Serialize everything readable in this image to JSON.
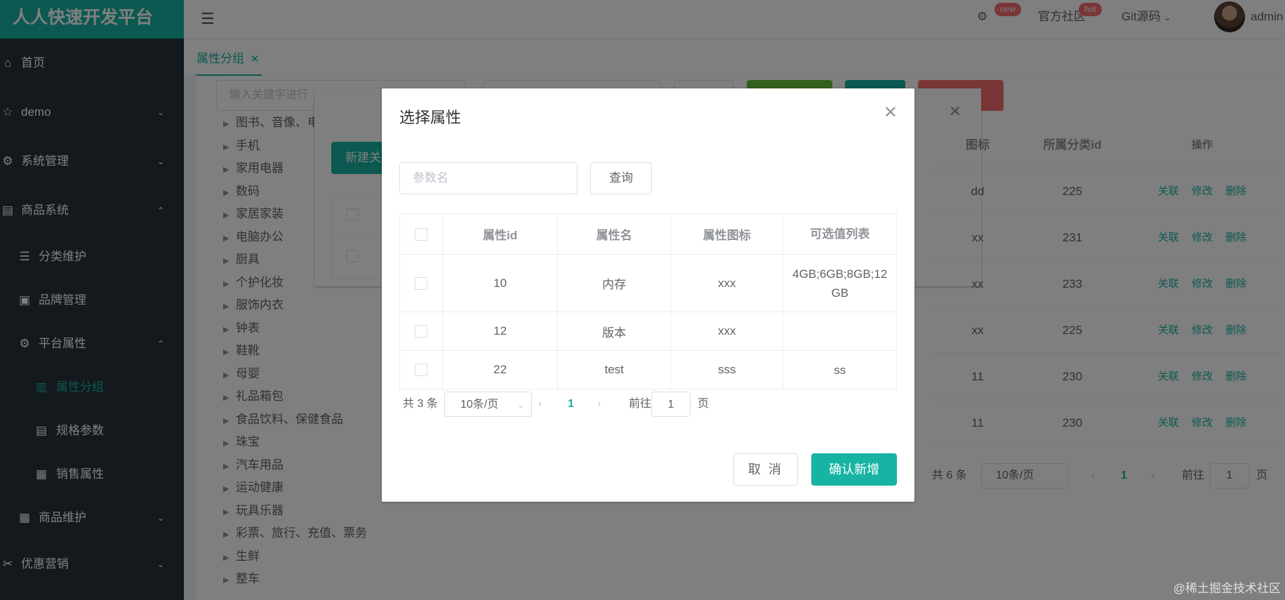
{
  "app": {
    "brand": "人人快速开发平台",
    "accent": "#17b3a3"
  },
  "sidebar": {
    "items": [
      {
        "label": "首页",
        "icon": "home-icon"
      },
      {
        "label": "demo",
        "icon": "star-icon"
      },
      {
        "label": "系统管理",
        "icon": "gear-icon"
      },
      {
        "label": "商品系统",
        "icon": "product-icon"
      },
      {
        "label": "分类维护",
        "icon": "list-icon"
      },
      {
        "label": "品牌管理",
        "icon": "brand-icon"
      },
      {
        "label": "平台属性",
        "icon": "gear-icon"
      },
      {
        "label": "属性分组",
        "icon": "bar-chart-icon"
      },
      {
        "label": "规格参数",
        "icon": "document-icon"
      },
      {
        "label": "销售属性",
        "icon": "grid-icon"
      },
      {
        "label": "商品维护",
        "icon": "grid-icon"
      },
      {
        "label": "优惠营销",
        "icon": "coupon-icon"
      }
    ]
  },
  "header": {
    "settings_badge": "new",
    "community": "官方社区",
    "community_badge": "hot",
    "git": "Git源码",
    "user": "admin"
  },
  "tabs": {
    "active": "属性分组"
  },
  "main": {
    "keyword_placeholder": "输入关键字进行",
    "tree": [
      "图书、音像、电",
      "手机",
      "家用电器",
      "数码",
      "家居家装",
      "电脑办公",
      "厨具",
      "个护化妆",
      "服饰内衣",
      "钟表",
      "鞋靴",
      "母婴",
      "礼品箱包",
      "食品饮料、保健食品",
      "珠宝",
      "汽车用品",
      "运动健康",
      "玩具乐器",
      "彩票、旅行、充值、票务",
      "生鲜",
      "整车"
    ],
    "bg_new_button": "新建关",
    "bg_table_headers": [
      "图标",
      "所属分类id",
      "操作"
    ],
    "bg_rows": [
      [
        "dd",
        "225"
      ],
      [
        "xx",
        "231"
      ],
      [
        "xx",
        "233"
      ],
      [
        "xx",
        "225"
      ],
      [
        "11",
        "230"
      ],
      [
        "11",
        "230"
      ]
    ],
    "bg_actions": "关联 修改 删除",
    "bg_total": "共 6 条",
    "bg_size": "10条/页",
    "bg_page": "1",
    "bg_goto": "前往",
    "bg_goto_value": "1",
    "bg_goto_suffix": "页"
  },
  "modal": {
    "title": "选择属性",
    "search_placeholder": "参数名",
    "query_button": "查询",
    "columns": [
      "属性id",
      "属性名",
      "属性图标",
      "可选值列表"
    ],
    "rows": [
      {
        "id": "10",
        "name": "内存",
        "icon": "xxx",
        "values": "4GB;6GB;8GB;12GB"
      },
      {
        "id": "12",
        "name": "版本",
        "icon": "xxx",
        "values": ""
      },
      {
        "id": "22",
        "name": "test",
        "icon": "sss",
        "values": "ss"
      }
    ],
    "pager": {
      "total": "共 3 条",
      "size": "10条/页",
      "page": "1",
      "goto": "前往",
      "goto_value": "1",
      "goto_suffix": "页"
    },
    "cancel": "取 消",
    "confirm": "确认新增"
  },
  "watermark": "@稀土掘金技术社区"
}
